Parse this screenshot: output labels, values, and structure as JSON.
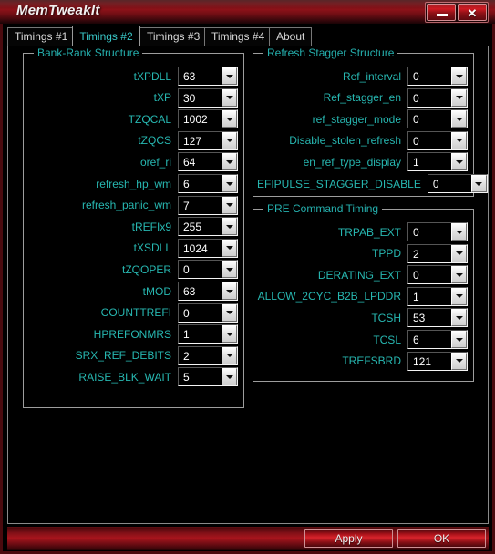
{
  "window": {
    "title": "MemTweakIt",
    "minimize_label": "",
    "close_label": "✕"
  },
  "tabs": [
    {
      "label": "Timings #1",
      "active": false
    },
    {
      "label": "Timings #2",
      "active": true
    },
    {
      "label": "Timings #3",
      "active": false
    },
    {
      "label": "Timings #4",
      "active": false
    },
    {
      "label": "About",
      "active": false
    }
  ],
  "groups": [
    {
      "id": "bank-rank-structure",
      "title": "Bank-Rank Structure",
      "fields": [
        {
          "label": "tXPDLL",
          "value": "63"
        },
        {
          "label": "tXP",
          "value": "30"
        },
        {
          "label": "TZQCAL",
          "value": "1002"
        },
        {
          "label": "tZQCS",
          "value": "127"
        },
        {
          "label": "oref_ri",
          "value": "64"
        },
        {
          "label": "refresh_hp_wm",
          "value": "6"
        },
        {
          "label": "refresh_panic_wm",
          "value": "7"
        },
        {
          "label": "tREFIx9",
          "value": "255"
        },
        {
          "label": "tXSDLL",
          "value": "1024"
        },
        {
          "label": "tZQOPER",
          "value": "0"
        },
        {
          "label": "tMOD",
          "value": "63"
        },
        {
          "label": "COUNTTREFI",
          "value": "0"
        },
        {
          "label": "HPREFONMRS",
          "value": "1"
        },
        {
          "label": "SRX_REF_DEBITS",
          "value": "2"
        },
        {
          "label": "RAISE_BLK_WAIT",
          "value": "5"
        }
      ]
    },
    {
      "id": "refresh-stagger-structure",
      "title": "Refresh Stagger Structure",
      "fields": [
        {
          "label": "Ref_interval",
          "value": "0"
        },
        {
          "label": "Ref_stagger_en",
          "value": "0"
        },
        {
          "label": "ref_stagger_mode",
          "value": "0"
        },
        {
          "label": "Disable_stolen_refresh",
          "value": "0"
        },
        {
          "label": "en_ref_type_display",
          "value": "1"
        },
        {
          "label": "EFIPULSE_STAGGER_DISABLE",
          "value": "0"
        }
      ]
    },
    {
      "id": "pre-command-timing",
      "title": "PRE Command Timing",
      "fields": [
        {
          "label": "TRPAB_EXT",
          "value": "0"
        },
        {
          "label": "TPPD",
          "value": "2"
        },
        {
          "label": "DERATING_EXT",
          "value": "0"
        },
        {
          "label": "ALLOW_2CYC_B2B_LPDDR",
          "value": "1"
        },
        {
          "label": "TCSH",
          "value": "53"
        },
        {
          "label": "TCSL",
          "value": "6"
        },
        {
          "label": "TREFSBRD",
          "value": "121"
        }
      ]
    }
  ],
  "footer": {
    "apply_label": "Apply",
    "ok_label": "OK"
  },
  "colors": {
    "label_teal": "#27b7b1",
    "group_title_teal": "#25b0ae",
    "active_tab_text": "#39c8c8",
    "accent_red": "#a8151d",
    "value_text": "#ffffff"
  }
}
